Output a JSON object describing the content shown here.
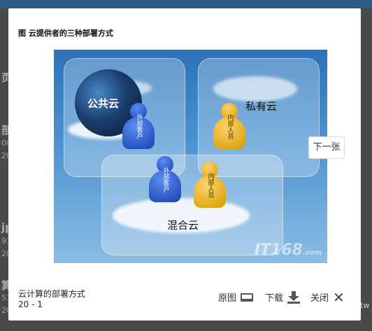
{
  "background": {
    "fragments": [
      "部",
      "00",
      "20",
      "jp",
      "91",
      "20",
      "算",
      "51",
      "20",
      "页",
      "tw"
    ]
  },
  "modal": {
    "title": "图 云提供者的三种部署方式",
    "image": {
      "public_cloud_label": "公共云",
      "private_cloud_label": "私有云",
      "hybrid_cloud_label": "混合云",
      "external_customer_label": "外部客户",
      "internal_staff_label": "内部人员",
      "watermark": "IT168",
      "watermark_suffix": ".com"
    },
    "next_button": "下一张",
    "caption": "云计算的部署方式",
    "counter": "20 - 1",
    "actions": {
      "original_label": "原图",
      "download_label": "下载",
      "close_label": "关闭"
    }
  },
  "icons": {
    "original": "monitor-icon",
    "download": "download-icon",
    "close": "close-icon"
  }
}
